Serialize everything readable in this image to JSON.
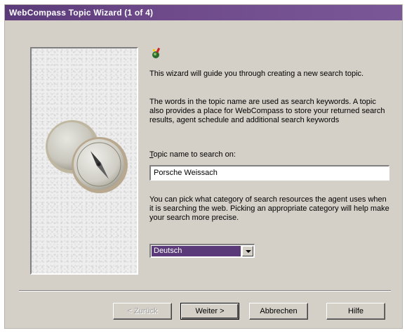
{
  "window": {
    "title": "WebCompass Topic Wizard (1 of 4)"
  },
  "intro": {
    "paragraph1": "This wizard will guide you through creating a new search topic.",
    "paragraph2": "The words in the topic name are used as search keywords.  A topic also provides a place for WebCompass to store your returned search results, agent schedule and additional search keywords"
  },
  "topic": {
    "label_accel": "T",
    "label_rest": "opic name to search on:",
    "value": "Porsche Weissach"
  },
  "category": {
    "description": "You can pick what category of search resources the agent uses when it is searching the web. Picking an appropriate category will help make your search more precise.",
    "selected": "Deutsch"
  },
  "buttons": {
    "back": "< Zurück",
    "next": "Weiter >",
    "cancel": "Abbrechen",
    "help": "Hilfe"
  },
  "icons": {
    "wizard": "wizard-icon",
    "illustration": "compass-illustration",
    "dropdown": "chevron-down-icon"
  }
}
